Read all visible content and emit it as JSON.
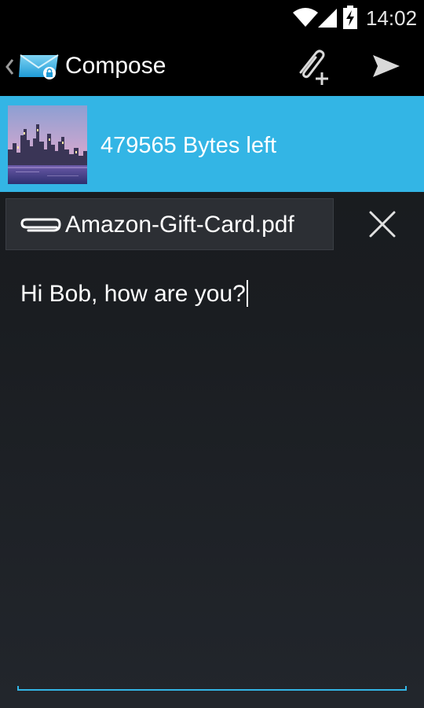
{
  "status_bar": {
    "time": "14:02",
    "icons": [
      "wifi-icon",
      "signal-icon",
      "battery-charging-icon"
    ]
  },
  "action_bar": {
    "title": "Compose",
    "icons": [
      "back-chevron-icon",
      "mail-app-icon",
      "attach-file-icon",
      "send-icon"
    ]
  },
  "size_bar": {
    "bytes_left": "479565 Bytes left",
    "background": "#33b5e5",
    "thumbnail": "city-skyline-photo"
  },
  "attachment": {
    "filename": "Amazon-Gift-Card.pdf",
    "icons": [
      "paperclip-icon",
      "close-icon"
    ]
  },
  "message": {
    "body": "Hi Bob, how are you?"
  },
  "colors": {
    "accent": "#33b5e5",
    "background": "#1a1d21",
    "action_bar": "#000000"
  }
}
